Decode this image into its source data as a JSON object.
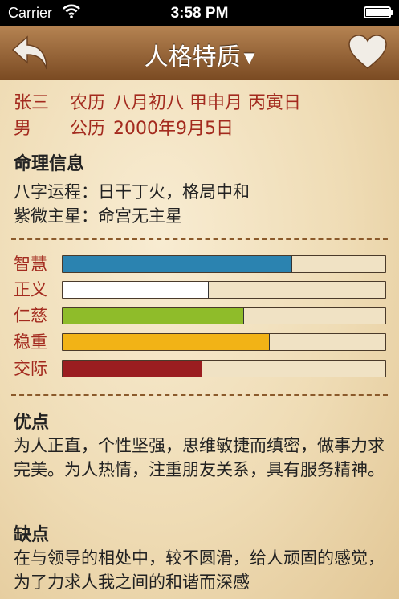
{
  "status_bar": {
    "carrier": "Carrier",
    "time": "3:58 PM",
    "battery_level": 1.0
  },
  "nav": {
    "title": "人格特质",
    "title_caret": "▼",
    "back_icon": "back-arrow-icon",
    "favorite_icon": "heart-icon"
  },
  "person": {
    "name": "张三",
    "gender": "男",
    "lunar_label": "农历",
    "lunar_date": "八月初八 甲申月 丙寅日",
    "solar_label": "公历",
    "solar_date": "2000年9月5日"
  },
  "fate_info": {
    "title": "命理信息",
    "lines": [
      "八字运程：日干丁火，格局中和",
      "紫微主星：命宫无主星"
    ]
  },
  "traits": [
    {
      "label": "智慧",
      "level": 0.71,
      "color": "#2b83b0"
    },
    {
      "label": "正义",
      "level": 0.45,
      "color": "#ffffff"
    },
    {
      "label": "仁慈",
      "level": 0.56,
      "color": "#8fbc2a"
    },
    {
      "label": "稳重",
      "level": 0.64,
      "color": "#f2b316"
    },
    {
      "label": "交际",
      "level": 0.43,
      "color": "#9b1d20"
    }
  ],
  "strengths": {
    "title": "优点",
    "text": "为人正直，个性坚强，思维敏捷而缜密，做事力求完美。为人热情，注重朋友关系，具有服务精神。"
  },
  "weaknesses": {
    "title": "缺点",
    "text": "在与领导的相处中，较不圆滑，给人顽固的感觉，为了力求人我之间的和谐而深感"
  },
  "colors": {
    "accent_text": "#a32a1e",
    "nav_top": "#b58352",
    "nav_bottom": "#7a4a22",
    "divider": "#8b5a2b"
  }
}
